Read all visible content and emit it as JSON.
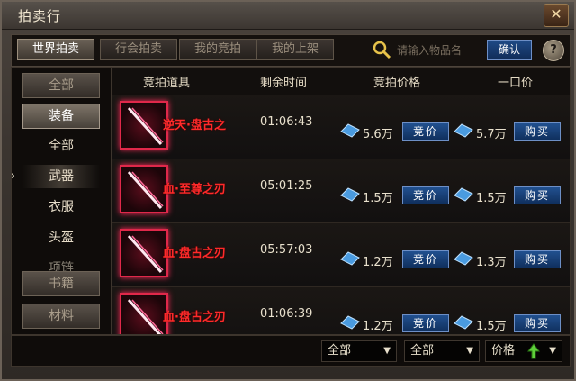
{
  "window": {
    "title": "拍卖行",
    "close_glyph": "✕"
  },
  "tabs": [
    {
      "label": "世界拍卖",
      "active": true
    },
    {
      "label": "行会拍卖",
      "active": false
    },
    {
      "label": "我的竞拍",
      "active": false
    },
    {
      "label": "我的上架",
      "active": false
    }
  ],
  "search": {
    "placeholder": "请输入物品名",
    "confirm_label": "确认",
    "help_label": "?"
  },
  "sidebar": {
    "all_label": "全部",
    "equipment_label": "装备",
    "sub_items": [
      "全部",
      "武器",
      "衣服",
      "头盔",
      "项链"
    ],
    "selected_sub": "武器",
    "books_label": "书籍",
    "materials_label": "材料"
  },
  "columns": {
    "item": "竞拍道具",
    "time": "剩余时间",
    "bid": "竞拍价格",
    "buyout": "一口价"
  },
  "rows": [
    {
      "name": "逆天·盘古之",
      "time": "01:06:43",
      "bid_price": "5.6万",
      "buyout_price": "5.7万",
      "bid_label": "竞价",
      "buy_label": "购买"
    },
    {
      "name": "血·至尊之刃",
      "time": "05:01:25",
      "bid_price": "1.5万",
      "buyout_price": "1.5万",
      "bid_label": "竞价",
      "buy_label": "购买"
    },
    {
      "name": "血·盘古之刃",
      "time": "05:57:03",
      "bid_price": "1.2万",
      "buyout_price": "1.3万",
      "bid_label": "竞价",
      "buy_label": "购买"
    },
    {
      "name": "血·盘古之刃",
      "time": "01:06:39",
      "bid_price": "1.2万",
      "buyout_price": "1.5万",
      "bid_label": "竞价",
      "buy_label": "购买"
    }
  ],
  "filters": {
    "filter1": "全部",
    "filter2": "全部",
    "sort": "价格"
  },
  "colors": {
    "item_name": "#ff2a2a",
    "button_blue": "#21508f",
    "accent_gold": "#e8dcc0"
  }
}
